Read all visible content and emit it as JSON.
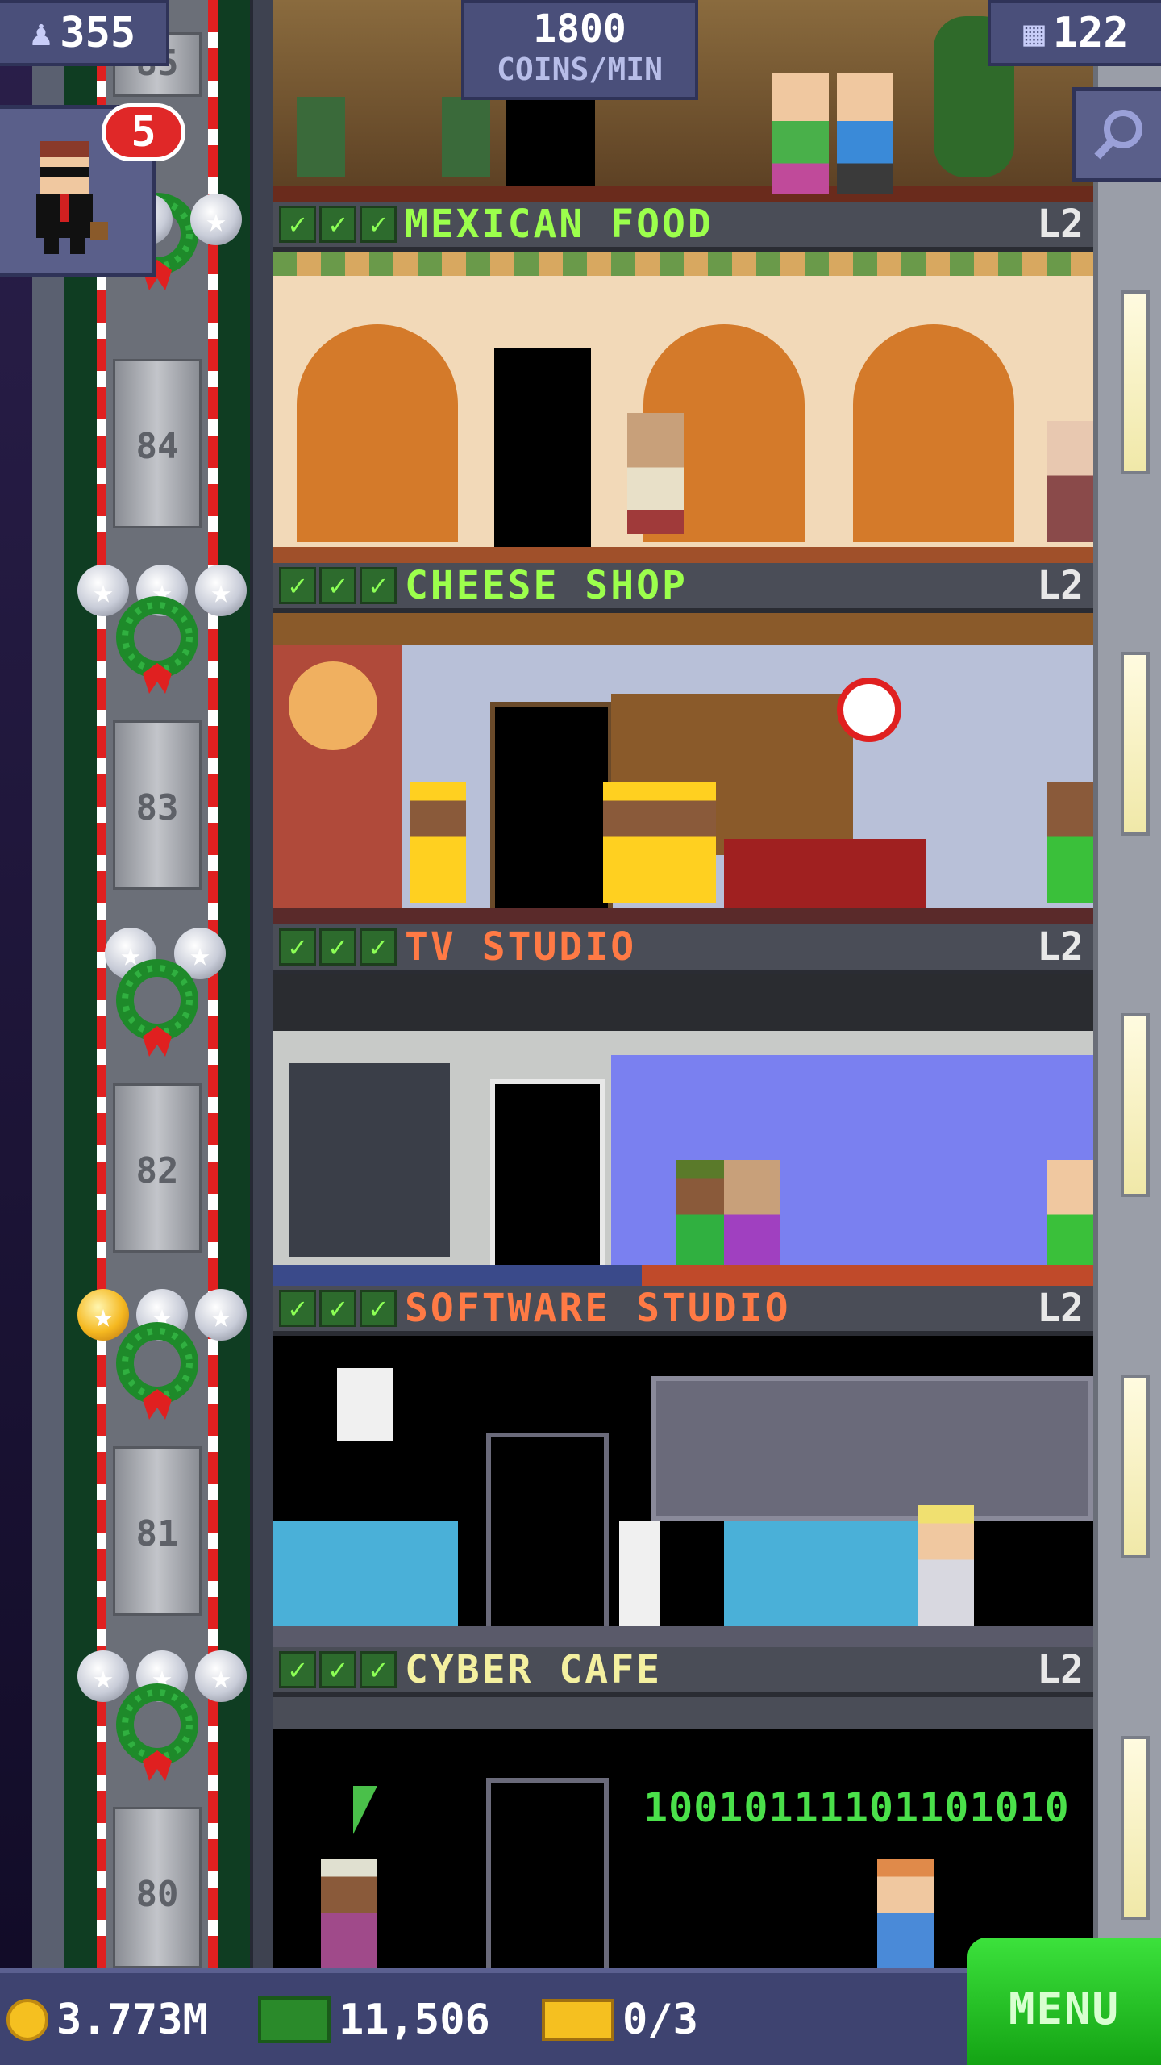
{
  "hud": {
    "population": "355",
    "coins_rate": "1800",
    "coins_rate_unit": "COINS/MIN",
    "floor_count": "122",
    "vip_count": "5"
  },
  "elevator": {
    "partial_floor_label": "85",
    "floor_labels": [
      "84",
      "83",
      "82",
      "81",
      "80"
    ]
  },
  "floors": [
    {
      "name": "MEXICAN FOOD",
      "level": "L2",
      "name_color": "#9cff4c",
      "checks": 3
    },
    {
      "name": "CHEESE SHOP",
      "level": "L2",
      "name_color": "#9cff4c",
      "checks": 3
    },
    {
      "name": "TV STUDIO",
      "level": "L2",
      "name_color": "#ff7a45",
      "checks": 3
    },
    {
      "name": "SOFTWARE STUDIO",
      "level": "L2",
      "name_color": "#ff7a45",
      "checks": 3
    },
    {
      "name": "CYBER CAFE",
      "level": "L2",
      "name_color": "#f4f0a0",
      "checks": 3
    }
  ],
  "scene_text": {
    "binary": "10010111101101010"
  },
  "bottom_bar": {
    "coins": "3.773M",
    "bux": "11,506",
    "tickets": "0/3",
    "menu_label": "MENU"
  },
  "colors": {
    "hud_bg": "#4a4f7a",
    "menu_green": "#2ecc2e",
    "check_green": "#8cff55"
  }
}
